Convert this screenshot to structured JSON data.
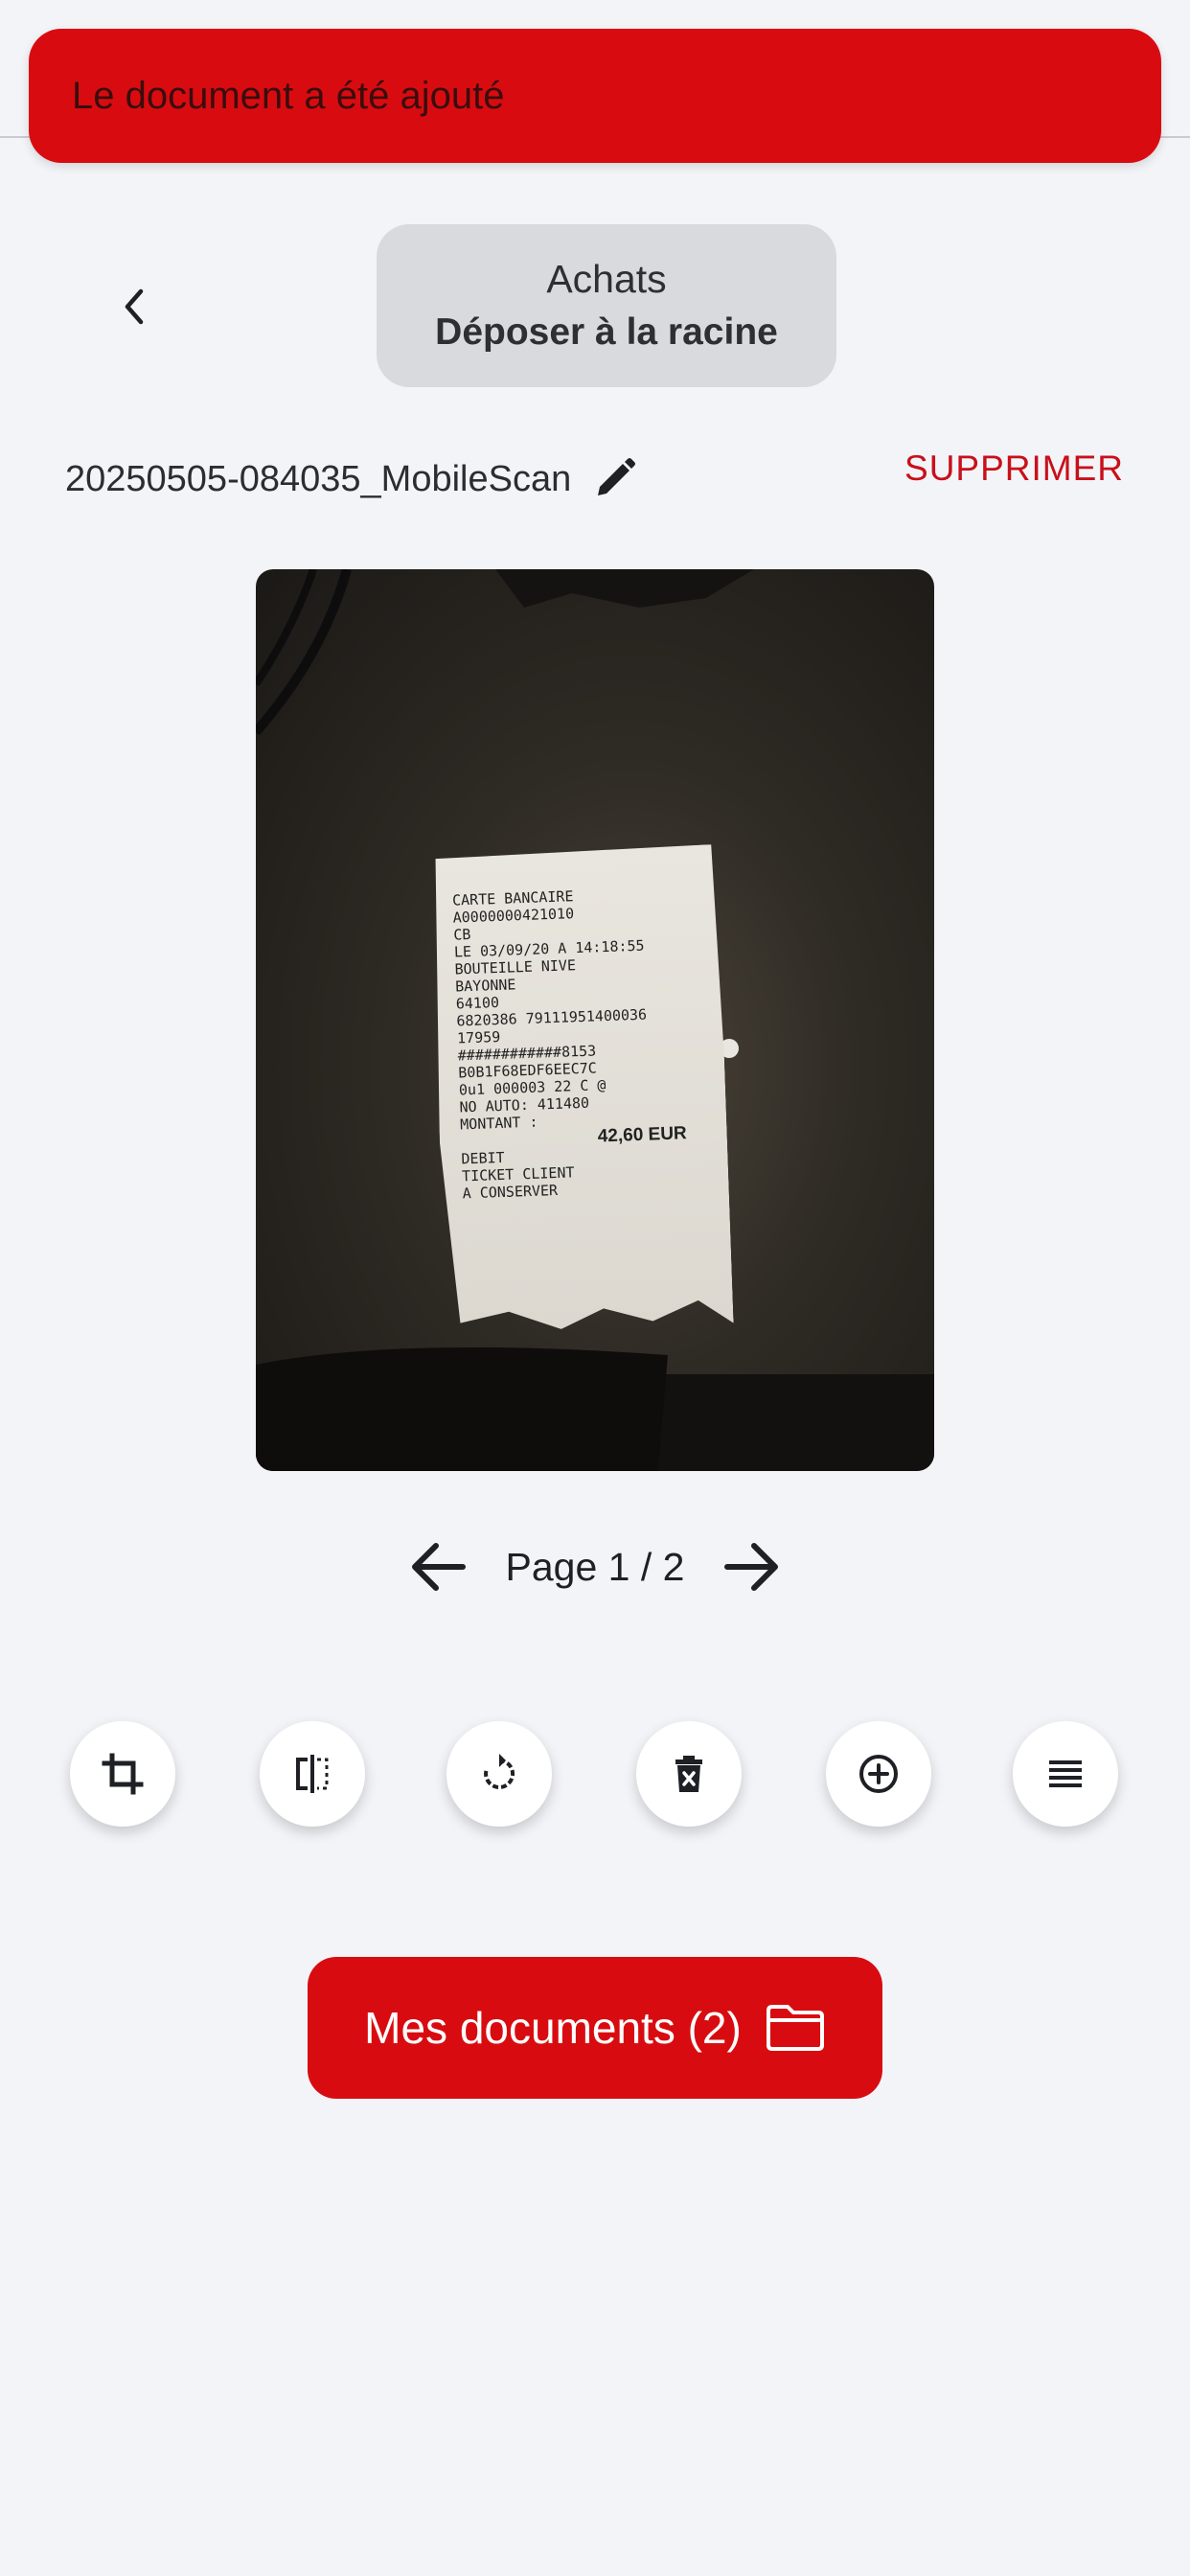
{
  "toast": {
    "message": "Le document a été ajouté"
  },
  "header": {
    "folder_name": "Achats",
    "folder_action": "Déposer à la racine"
  },
  "document": {
    "name": "20250505-084035_MobileScan",
    "delete_label": "SUPPRIMER"
  },
  "receipt": {
    "lines": [
      "CARTE BANCAIRE",
      "",
      "A0000000421010",
      "CB",
      "LE 03/09/20 A 14:18:55",
      "BOUTEILLE NIVE",
      "BAYONNE",
      "64100",
      "6820386 79111951400036",
      "17959",
      "############8153",
      "B0B1F68EDF6EEC7C",
      "0u1 000003 22 C @",
      "NO AUTO: 411480",
      "MONTANT :"
    ],
    "amount": "42,60 EUR",
    "footer": [
      "DEBIT",
      "TICKET CLIENT",
      "A CONSERVER"
    ]
  },
  "pager": {
    "label": "Page 1 / 2"
  },
  "toolbar": {
    "tools": [
      "crop-icon",
      "flip-icon",
      "rotate-icon",
      "delete-page-icon",
      "add-page-icon",
      "reorder-icon"
    ]
  },
  "main_button": {
    "label": "Mes documents (2)",
    "icon": "folder-icon"
  },
  "colors": {
    "accent": "#d80c10",
    "background": "#f3f4f8",
    "pill": "#d9dadd",
    "delete": "#c8101a"
  }
}
